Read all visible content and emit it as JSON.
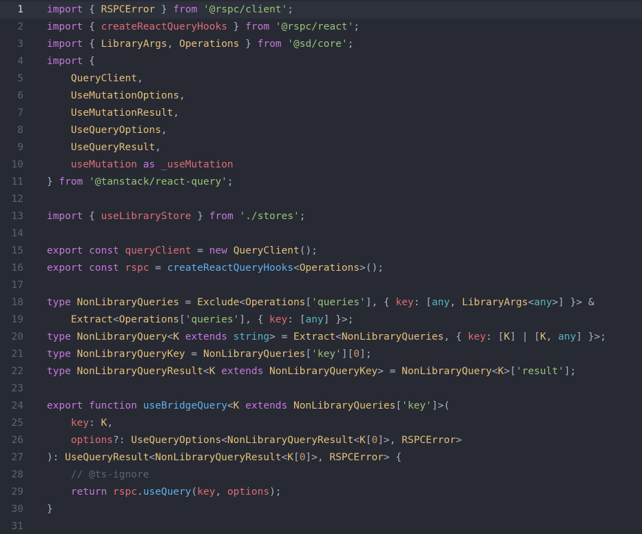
{
  "editor": {
    "lines": [
      {
        "num": "1",
        "tokens": [
          [
            "keyword",
            "import"
          ],
          [
            "punct",
            " { "
          ],
          [
            "type",
            "RSPCError"
          ],
          [
            "punct",
            " } "
          ],
          [
            "keyword",
            "from"
          ],
          [
            "punct",
            " "
          ],
          [
            "string",
            "'@rspc/client'"
          ],
          [
            "punct",
            ";"
          ]
        ]
      },
      {
        "num": "2",
        "tokens": [
          [
            "keyword",
            "import"
          ],
          [
            "punct",
            " { "
          ],
          [
            "var",
            "createReactQueryHooks"
          ],
          [
            "punct",
            " } "
          ],
          [
            "keyword",
            "from"
          ],
          [
            "punct",
            " "
          ],
          [
            "string",
            "'@rspc/react'"
          ],
          [
            "punct",
            ";"
          ]
        ]
      },
      {
        "num": "3",
        "tokens": [
          [
            "keyword",
            "import"
          ],
          [
            "punct",
            " { "
          ],
          [
            "type",
            "LibraryArgs"
          ],
          [
            "punct",
            ", "
          ],
          [
            "type",
            "Operations"
          ],
          [
            "punct",
            " } "
          ],
          [
            "keyword",
            "from"
          ],
          [
            "punct",
            " "
          ],
          [
            "string",
            "'@sd/core'"
          ],
          [
            "punct",
            ";"
          ]
        ]
      },
      {
        "num": "4",
        "tokens": [
          [
            "keyword",
            "import"
          ],
          [
            "punct",
            " {"
          ]
        ]
      },
      {
        "num": "5",
        "tokens": [
          [
            "plain",
            "    "
          ],
          [
            "type",
            "QueryClient"
          ],
          [
            "punct",
            ","
          ]
        ]
      },
      {
        "num": "6",
        "tokens": [
          [
            "plain",
            "    "
          ],
          [
            "type",
            "UseMutationOptions"
          ],
          [
            "punct",
            ","
          ]
        ]
      },
      {
        "num": "7",
        "tokens": [
          [
            "plain",
            "    "
          ],
          [
            "type",
            "UseMutationResult"
          ],
          [
            "punct",
            ","
          ]
        ]
      },
      {
        "num": "8",
        "tokens": [
          [
            "plain",
            "    "
          ],
          [
            "type",
            "UseQueryOptions"
          ],
          [
            "punct",
            ","
          ]
        ]
      },
      {
        "num": "9",
        "tokens": [
          [
            "plain",
            "    "
          ],
          [
            "type",
            "UseQueryResult"
          ],
          [
            "punct",
            ","
          ]
        ]
      },
      {
        "num": "10",
        "tokens": [
          [
            "plain",
            "    "
          ],
          [
            "var",
            "useMutation"
          ],
          [
            "plain",
            " "
          ],
          [
            "keyword",
            "as"
          ],
          [
            "plain",
            " "
          ],
          [
            "var",
            "_useMutation"
          ]
        ]
      },
      {
        "num": "11",
        "tokens": [
          [
            "punct",
            "} "
          ],
          [
            "keyword",
            "from"
          ],
          [
            "punct",
            " "
          ],
          [
            "string",
            "'@tanstack/react-query'"
          ],
          [
            "punct",
            ";"
          ]
        ]
      },
      {
        "num": "12",
        "tokens": []
      },
      {
        "num": "13",
        "tokens": [
          [
            "keyword",
            "import"
          ],
          [
            "punct",
            " { "
          ],
          [
            "var",
            "useLibraryStore"
          ],
          [
            "punct",
            " } "
          ],
          [
            "keyword",
            "from"
          ],
          [
            "punct",
            " "
          ],
          [
            "string",
            "'./stores'"
          ],
          [
            "punct",
            ";"
          ]
        ]
      },
      {
        "num": "14",
        "tokens": []
      },
      {
        "num": "15",
        "tokens": [
          [
            "keyword",
            "export"
          ],
          [
            "plain",
            " "
          ],
          [
            "keyword",
            "const"
          ],
          [
            "plain",
            " "
          ],
          [
            "var",
            "queryClient"
          ],
          [
            "punct",
            " = "
          ],
          [
            "keyword",
            "new"
          ],
          [
            "plain",
            " "
          ],
          [
            "type",
            "QueryClient"
          ],
          [
            "punct",
            "();"
          ]
        ]
      },
      {
        "num": "16",
        "tokens": [
          [
            "keyword",
            "export"
          ],
          [
            "plain",
            " "
          ],
          [
            "keyword",
            "const"
          ],
          [
            "plain",
            " "
          ],
          [
            "var",
            "rspc"
          ],
          [
            "punct",
            " = "
          ],
          [
            "function",
            "createReactQueryHooks"
          ],
          [
            "punct",
            "<"
          ],
          [
            "type",
            "Operations"
          ],
          [
            "punct",
            ">();"
          ]
        ]
      },
      {
        "num": "17",
        "tokens": []
      },
      {
        "num": "18",
        "tokens": [
          [
            "keyword",
            "type"
          ],
          [
            "plain",
            " "
          ],
          [
            "type",
            "NonLibraryQueries"
          ],
          [
            "punct",
            " = "
          ],
          [
            "type",
            "Exclude"
          ],
          [
            "punct",
            "<"
          ],
          [
            "type",
            "Operations"
          ],
          [
            "punct",
            "["
          ],
          [
            "string",
            "'queries'"
          ],
          [
            "punct",
            "], { "
          ],
          [
            "var",
            "key"
          ],
          [
            "punct",
            ": ["
          ],
          [
            "builtin",
            "any"
          ],
          [
            "punct",
            ", "
          ],
          [
            "type",
            "LibraryArgs"
          ],
          [
            "punct",
            "<"
          ],
          [
            "builtin",
            "any"
          ],
          [
            "punct",
            ">] }> &"
          ]
        ]
      },
      {
        "num": "19",
        "tokens": [
          [
            "plain",
            "    "
          ],
          [
            "type",
            "Extract"
          ],
          [
            "punct",
            "<"
          ],
          [
            "type",
            "Operations"
          ],
          [
            "punct",
            "["
          ],
          [
            "string",
            "'queries'"
          ],
          [
            "punct",
            "], { "
          ],
          [
            "var",
            "key"
          ],
          [
            "punct",
            ": ["
          ],
          [
            "builtin",
            "any"
          ],
          [
            "punct",
            "] }>;"
          ]
        ]
      },
      {
        "num": "20",
        "tokens": [
          [
            "keyword",
            "type"
          ],
          [
            "plain",
            " "
          ],
          [
            "type",
            "NonLibraryQuery"
          ],
          [
            "punct",
            "<"
          ],
          [
            "type",
            "K"
          ],
          [
            "plain",
            " "
          ],
          [
            "keyword",
            "extends"
          ],
          [
            "plain",
            " "
          ],
          [
            "builtin",
            "string"
          ],
          [
            "punct",
            "> = "
          ],
          [
            "type",
            "Extract"
          ],
          [
            "punct",
            "<"
          ],
          [
            "type",
            "NonLibraryQueries"
          ],
          [
            "punct",
            ", { "
          ],
          [
            "var",
            "key"
          ],
          [
            "punct",
            ": ["
          ],
          [
            "type",
            "K"
          ],
          [
            "punct",
            "] | ["
          ],
          [
            "type",
            "K"
          ],
          [
            "punct",
            ", "
          ],
          [
            "builtin",
            "any"
          ],
          [
            "punct",
            "] }>;"
          ]
        ]
      },
      {
        "num": "21",
        "tokens": [
          [
            "keyword",
            "type"
          ],
          [
            "plain",
            " "
          ],
          [
            "type",
            "NonLibraryQueryKey"
          ],
          [
            "punct",
            " = "
          ],
          [
            "type",
            "NonLibraryQueries"
          ],
          [
            "punct",
            "["
          ],
          [
            "string",
            "'key'"
          ],
          [
            "punct",
            "]["
          ],
          [
            "number",
            "0"
          ],
          [
            "punct",
            "];"
          ]
        ]
      },
      {
        "num": "22",
        "tokens": [
          [
            "keyword",
            "type"
          ],
          [
            "plain",
            " "
          ],
          [
            "type",
            "NonLibraryQueryResult"
          ],
          [
            "punct",
            "<"
          ],
          [
            "type",
            "K"
          ],
          [
            "plain",
            " "
          ],
          [
            "keyword",
            "extends"
          ],
          [
            "plain",
            " "
          ],
          [
            "type",
            "NonLibraryQueryKey"
          ],
          [
            "punct",
            "> = "
          ],
          [
            "type",
            "NonLibraryQuery"
          ],
          [
            "punct",
            "<"
          ],
          [
            "type",
            "K"
          ],
          [
            "punct",
            ">["
          ],
          [
            "string",
            "'result'"
          ],
          [
            "punct",
            "];"
          ]
        ]
      },
      {
        "num": "23",
        "tokens": []
      },
      {
        "num": "24",
        "tokens": [
          [
            "keyword",
            "export"
          ],
          [
            "plain",
            " "
          ],
          [
            "keyword",
            "function"
          ],
          [
            "plain",
            " "
          ],
          [
            "function",
            "useBridgeQuery"
          ],
          [
            "punct",
            "<"
          ],
          [
            "type",
            "K"
          ],
          [
            "plain",
            " "
          ],
          [
            "keyword",
            "extends"
          ],
          [
            "plain",
            " "
          ],
          [
            "type",
            "NonLibraryQueries"
          ],
          [
            "punct",
            "["
          ],
          [
            "string",
            "'key'"
          ],
          [
            "punct",
            "]>("
          ]
        ]
      },
      {
        "num": "25",
        "tokens": [
          [
            "plain",
            "    "
          ],
          [
            "var",
            "key"
          ],
          [
            "punct",
            ": "
          ],
          [
            "type",
            "K"
          ],
          [
            "punct",
            ","
          ]
        ]
      },
      {
        "num": "26",
        "tokens": [
          [
            "plain",
            "    "
          ],
          [
            "var",
            "options"
          ],
          [
            "punct",
            "?: "
          ],
          [
            "type",
            "UseQueryOptions"
          ],
          [
            "punct",
            "<"
          ],
          [
            "type",
            "NonLibraryQueryResult"
          ],
          [
            "punct",
            "<"
          ],
          [
            "type",
            "K"
          ],
          [
            "punct",
            "["
          ],
          [
            "number",
            "0"
          ],
          [
            "punct",
            "]>, "
          ],
          [
            "type",
            "RSPCError"
          ],
          [
            "punct",
            ">"
          ]
        ]
      },
      {
        "num": "27",
        "tokens": [
          [
            "punct",
            "): "
          ],
          [
            "type",
            "UseQueryResult"
          ],
          [
            "punct",
            "<"
          ],
          [
            "type",
            "NonLibraryQueryResult"
          ],
          [
            "punct",
            "<"
          ],
          [
            "type",
            "K"
          ],
          [
            "punct",
            "["
          ],
          [
            "number",
            "0"
          ],
          [
            "punct",
            "]>, "
          ],
          [
            "type",
            "RSPCError"
          ],
          [
            "punct",
            "> {"
          ]
        ]
      },
      {
        "num": "28",
        "tokens": [
          [
            "plain",
            "    "
          ],
          [
            "comment",
            "// @ts-ignore"
          ]
        ]
      },
      {
        "num": "29",
        "tokens": [
          [
            "plain",
            "    "
          ],
          [
            "keyword",
            "return"
          ],
          [
            "plain",
            " "
          ],
          [
            "var",
            "rspc"
          ],
          [
            "punct",
            "."
          ],
          [
            "function",
            "useQuery"
          ],
          [
            "punct",
            "("
          ],
          [
            "var",
            "key"
          ],
          [
            "punct",
            ", "
          ],
          [
            "var",
            "options"
          ],
          [
            "punct",
            ");"
          ]
        ]
      },
      {
        "num": "30",
        "tokens": [
          [
            "punct",
            "}"
          ]
        ]
      },
      {
        "num": "31",
        "tokens": []
      }
    ],
    "active_line": "1",
    "colors": {
      "background": "#272a33",
      "active_line": "#2d313b",
      "keyword": "#c678dd",
      "string": "#98c379",
      "function": "#61afef",
      "type": "#e5c07b",
      "variable": "#e06c75",
      "comment": "#5c6370"
    }
  }
}
